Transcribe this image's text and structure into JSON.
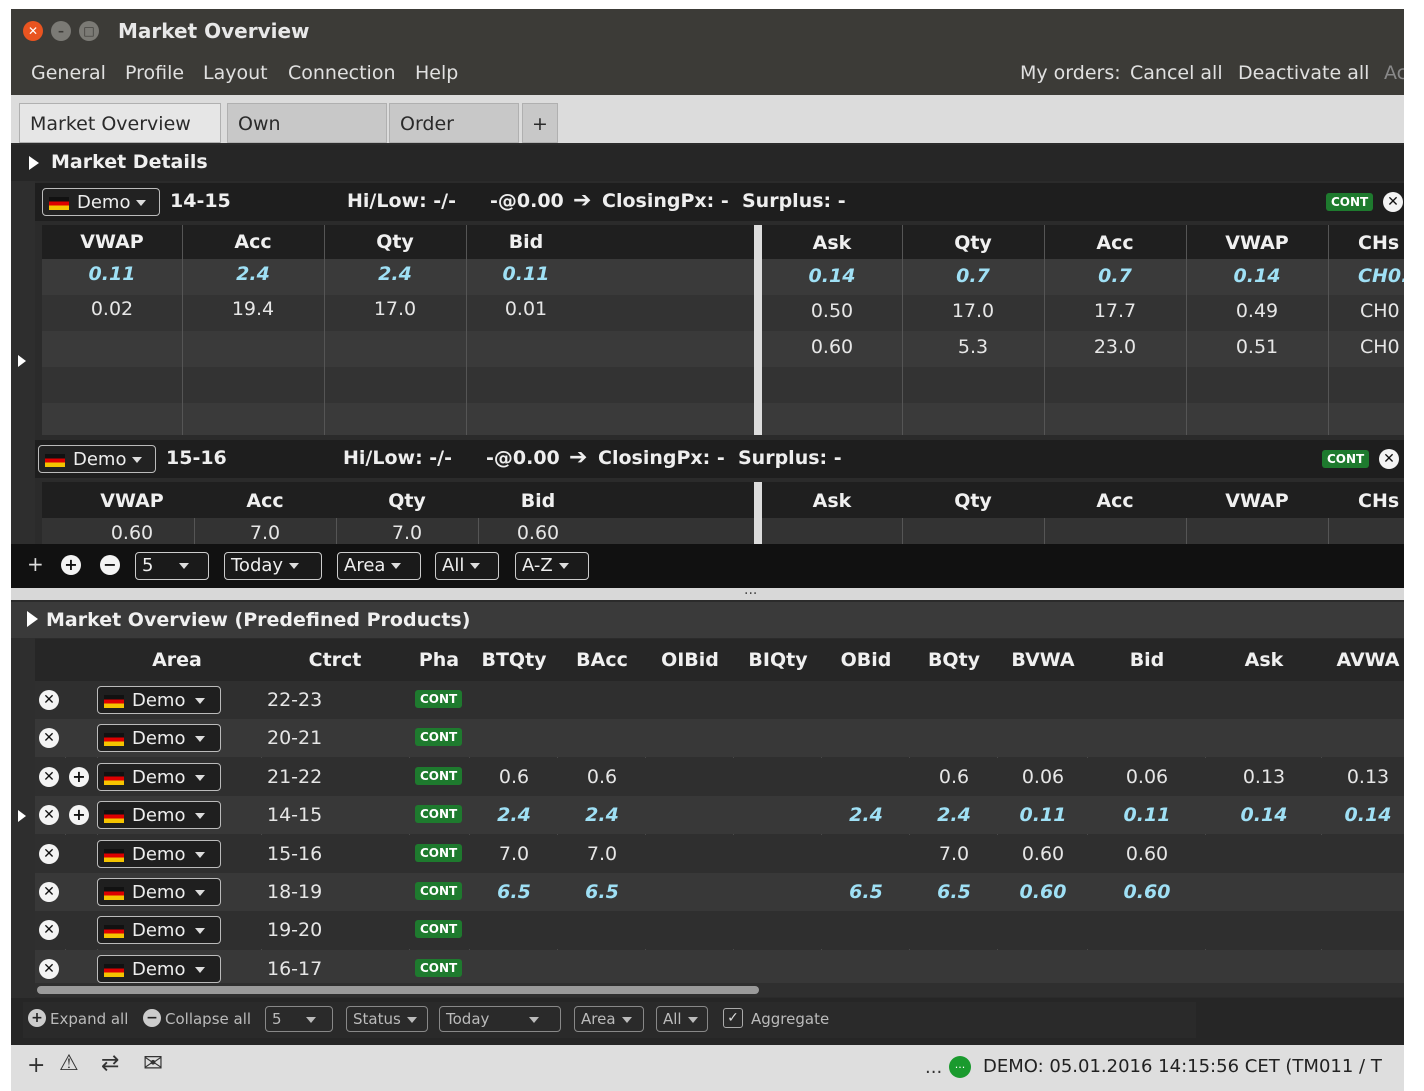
{
  "window": {
    "title": "Market Overview"
  },
  "menu": {
    "items": [
      "General",
      "Profile",
      "Layout",
      "Connection",
      "Help"
    ],
    "my_orders": "My orders:",
    "cancel_all": "Cancel all",
    "deactivate_all": "Deactivate all",
    "ac": "Ac"
  },
  "tabs": {
    "market_overview": "Market Overview ✕",
    "own_overview": "Own Overview",
    "order_entry": "Order Entry",
    "add": "+"
  },
  "market_details": {
    "title": "Market Details",
    "panels": [
      {
        "area": "Demo",
        "contract": "14-15",
        "hilow": "Hi/Low:  -/-",
        "last": "-@0.00",
        "closing": "ClosingPx: -",
        "surplus": "Surplus:  -",
        "phase": "CONT"
      },
      {
        "area": "Demo",
        "contract": "15-16",
        "hilow": "Hi/Low:  -/-",
        "last": "-@0.00",
        "closing": "ClosingPx: -",
        "surplus": "Surplus:  -",
        "phase": "CONT"
      }
    ],
    "bid_headers": [
      "VWAP",
      "Acc",
      "Qty",
      "Bid"
    ],
    "ask_headers": [
      "Ask",
      "Qty",
      "Acc",
      "VWAP",
      "CHs"
    ],
    "panel1_bid_rows": [
      [
        "0.11",
        "2.4",
        "2.4",
        "0.11"
      ],
      [
        "0.02",
        "19.4",
        "17.0",
        "0.01"
      ]
    ],
    "panel1_ask_rows": [
      [
        "0.14",
        "0.7",
        "0.7",
        "0.14",
        "CH0."
      ],
      [
        "0.50",
        "17.0",
        "17.7",
        "0.49",
        "CH0"
      ],
      [
        "0.60",
        "5.3",
        "23.0",
        "0.51",
        "CH0"
      ]
    ],
    "panel2_bid_rows": [
      [
        "0.60",
        "7.0",
        "7.0",
        "0.60"
      ]
    ]
  },
  "toolbar1": {
    "plus": "+",
    "depth": "5",
    "period": "Today",
    "group": "Area",
    "filter": "All",
    "sort": "A-Z"
  },
  "divider": "...",
  "overview": {
    "title": "Market Overview (Predefined Products)",
    "headers": [
      "Area",
      "Ctrct",
      "Pha",
      "BTQty",
      "BAcc",
      "OIBid",
      "BIQty",
      "OBid",
      "BQty",
      "BVWA",
      "Bid",
      "Ask",
      "AVWA"
    ],
    "rows": [
      {
        "area": "Demo",
        "ctrct": "22-23",
        "pha": "CONT",
        "plus": false,
        "hl": false,
        "btqty": "",
        "bacc": "",
        "obid": "",
        "bqty": "",
        "bvwa": "",
        "bid": "",
        "ask": "",
        "avwa": ""
      },
      {
        "area": "Demo",
        "ctrct": "20-21",
        "pha": "CONT",
        "plus": false,
        "hl": false,
        "btqty": "",
        "bacc": "",
        "obid": "",
        "bqty": "",
        "bvwa": "",
        "bid": "",
        "ask": "",
        "avwa": ""
      },
      {
        "area": "Demo",
        "ctrct": "21-22",
        "pha": "CONT",
        "plus": true,
        "hl": false,
        "btqty": "0.6",
        "bacc": "0.6",
        "obid": "",
        "bqty": "0.6",
        "bvwa": "0.06",
        "bid": "0.06",
        "ask": "0.13",
        "avwa": "0.13"
      },
      {
        "area": "Demo",
        "ctrct": "14-15",
        "pha": "CONT",
        "plus": true,
        "hl": true,
        "btqty": "2.4",
        "bacc": "2.4",
        "obid": "2.4",
        "bqty": "2.4",
        "bvwa": "0.11",
        "bid": "0.11",
        "ask": "0.14",
        "avwa": "0.14"
      },
      {
        "area": "Demo",
        "ctrct": "15-16",
        "pha": "CONT",
        "plus": false,
        "hl": false,
        "btqty": "7.0",
        "bacc": "7.0",
        "obid": "",
        "bqty": "7.0",
        "bvwa": "0.60",
        "bid": "0.60",
        "ask": "",
        "avwa": ""
      },
      {
        "area": "Demo",
        "ctrct": "18-19",
        "pha": "CONT",
        "plus": false,
        "hl": true,
        "btqty": "6.5",
        "bacc": "6.5",
        "obid": "6.5",
        "bqty": "6.5",
        "bvwa": "0.60",
        "bid": "0.60",
        "ask": "",
        "avwa": ""
      },
      {
        "area": "Demo",
        "ctrct": "19-20",
        "pha": "CONT",
        "plus": false,
        "hl": false,
        "btqty": "",
        "bacc": "",
        "obid": "",
        "bqty": "",
        "bvwa": "",
        "bid": "",
        "ask": "",
        "avwa": ""
      },
      {
        "area": "Demo",
        "ctrct": "16-17",
        "pha": "CONT",
        "plus": false,
        "hl": false,
        "btqty": "",
        "bacc": "",
        "obid": "",
        "bqty": "",
        "bvwa": "",
        "bid": "",
        "ask": "",
        "avwa": ""
      }
    ]
  },
  "toolbar2": {
    "expand": "Expand all",
    "collapse": "Collapse all",
    "depth": "5",
    "status": "Status",
    "period": "Today",
    "area": "Area",
    "all": "All",
    "aggregate": "Aggregate"
  },
  "statusbar": {
    "plus": "+",
    "ellipsis": "...",
    "chat": "...",
    "text": "DEMO: 05.01.2016 14:15:56 CET (TM011 / T"
  }
}
